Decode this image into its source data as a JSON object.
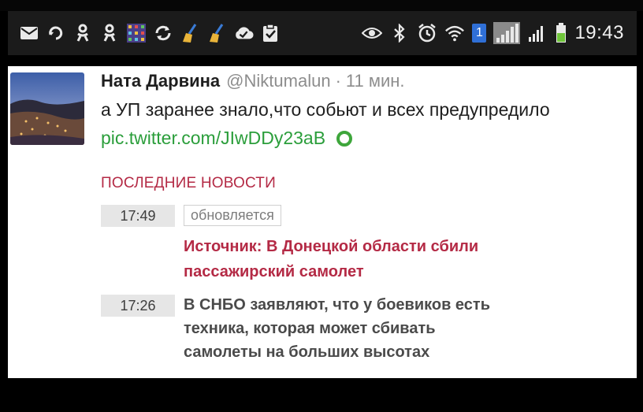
{
  "statusbar": {
    "left_icons": [
      "mail-icon",
      "refresh-contact-icon",
      "odnoklassniki-icon",
      "odnoklassniki-icon-2",
      "image-grid-icon",
      "sync-icon",
      "cleaner-icon",
      "cleaner-icon-2",
      "cloud-check-icon",
      "clipboard-check-icon"
    ],
    "right_icons": [
      "eye-icon",
      "bluetooth-icon",
      "alarm-icon",
      "wifi-icon",
      "sim1-badge-icon",
      "signal-icon",
      "signal-icon-2",
      "battery-icon"
    ],
    "sim_number": "1",
    "clock": "19:43"
  },
  "tweet": {
    "author": "Ната Дарвина",
    "handle": "@Niktumalun",
    "separator": "·",
    "time": "11 мин.",
    "text": "а УП заранее знало,что собьют и всех предупредило",
    "link": "pic.twitter.com/JIwDDy23aB"
  },
  "news": {
    "header": "ПОСЛЕДНИЕ НОВОСТИ",
    "items": [
      {
        "time": "17:49",
        "status": "обновляется",
        "headline_line1": "Источник: В Донецкой области сбили",
        "headline_line2": "пассажирский самолет"
      },
      {
        "time": "17:26",
        "headline_line1": "В СНБО заявляют, что у боевиков есть",
        "headline_line2": "техника, которая может сбивать",
        "headline_line3": "самолеты на больших высотах"
      }
    ]
  },
  "colors": {
    "link_green": "#2b9e3b",
    "news_red": "#b42a45",
    "statusbar_bg": "#1b1b1b"
  }
}
